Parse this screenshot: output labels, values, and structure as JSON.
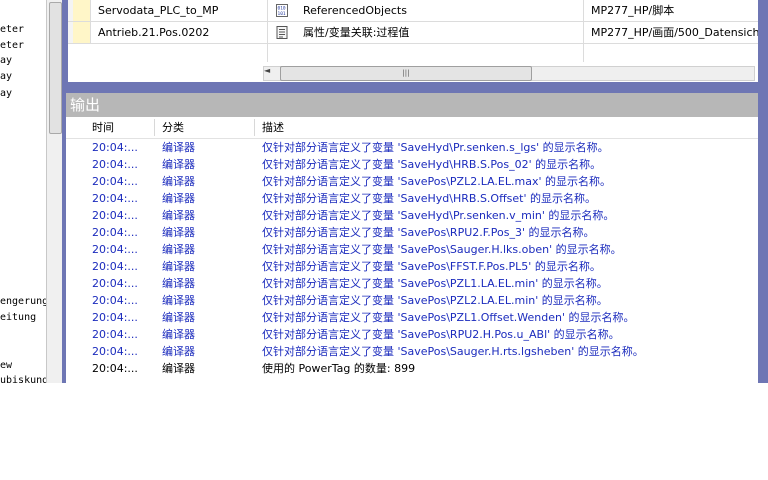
{
  "left_tree": {
    "items": [
      "eter",
      "eter",
      "ay",
      "ay",
      "ay",
      "engerung",
      "eitung",
      "ew",
      "ubiskung"
    ]
  },
  "grid": {
    "rows": [
      {
        "name": "Servodata_PLC_to_MP",
        "icon": "binary-object-icon",
        "type": "ReferencedObjects",
        "path": "MP277_HP/脚本"
      },
      {
        "name": "Antrieb.21.Pos.0202",
        "icon": "document-icon",
        "type": "属性/变量关联:过程值",
        "path": "MP277_HP/画面/500_Datensiche"
      }
    ],
    "scroll_arrow": "◄",
    "scroll_thumb_grip": "|||"
  },
  "output": {
    "title": "输出",
    "columns": {
      "time": "时间",
      "category": "分类",
      "description": "描述"
    },
    "rows": [
      {
        "time": "20:04:...",
        "category": "编译器",
        "description": "仅针对部分语言定义了变量 'SaveHyd\\Pr.senken.s_lgs' 的显示名称。",
        "color": "#1b2bbd"
      },
      {
        "time": "20:04:...",
        "category": "编译器",
        "description": "仅针对部分语言定义了变量 'SaveHyd\\HRB.S.Pos_02' 的显示名称。",
        "color": "#1b2bbd"
      },
      {
        "time": "20:04:...",
        "category": "编译器",
        "description": "仅针对部分语言定义了变量 'SavePos\\PZL2.LA.EL.max' 的显示名称。",
        "color": "#1b2bbd"
      },
      {
        "time": "20:04:...",
        "category": "编译器",
        "description": "仅针对部分语言定义了变量 'SaveHyd\\HRB.S.Offset' 的显示名称。",
        "color": "#1b2bbd"
      },
      {
        "time": "20:04:...",
        "category": "编译器",
        "description": "仅针对部分语言定义了变量 'SaveHyd\\Pr.senken.v_min' 的显示名称。",
        "color": "#1b2bbd"
      },
      {
        "time": "20:04:...",
        "category": "编译器",
        "description": "仅针对部分语言定义了变量 'SavePos\\RPU2.F.Pos_3' 的显示名称。",
        "color": "#1b2bbd"
      },
      {
        "time": "20:04:...",
        "category": "编译器",
        "description": "仅针对部分语言定义了变量 'SavePos\\Sauger.H.lks.oben' 的显示名称。",
        "color": "#1b2bbd"
      },
      {
        "time": "20:04:...",
        "category": "编译器",
        "description": "仅针对部分语言定义了变量 'SavePos\\FFST.F.Pos.PL5' 的显示名称。",
        "color": "#1b2bbd"
      },
      {
        "time": "20:04:...",
        "category": "编译器",
        "description": "仅针对部分语言定义了变量 'SavePos\\PZL1.LA.EL.min' 的显示名称。",
        "color": "#1b2bbd"
      },
      {
        "time": "20:04:...",
        "category": "编译器",
        "description": "仅针对部分语言定义了变量 'SavePos\\PZL2.LA.EL.min' 的显示名称。",
        "color": "#1b2bbd"
      },
      {
        "time": "20:04:...",
        "category": "编译器",
        "description": "仅针对部分语言定义了变量 'SavePos\\PZL1.Offset.Wenden' 的显示名称。",
        "color": "#1b2bbd"
      },
      {
        "time": "20:04:...",
        "category": "编译器",
        "description": "仅针对部分语言定义了变量 'SavePos\\RPU2.H.Pos.u_ABl' 的显示名称。",
        "color": "#1b2bbd"
      },
      {
        "time": "20:04:...",
        "category": "编译器",
        "description": "仅针对部分语言定义了变量 'SavePos\\Sauger.H.rts.lgsheben' 的显示名称。",
        "color": "#1b2bbd"
      },
      {
        "time": "20:04:...",
        "category": "编译器",
        "description": "使用的 PowerTag 的数量: 899",
        "color": "#000000"
      }
    ]
  }
}
